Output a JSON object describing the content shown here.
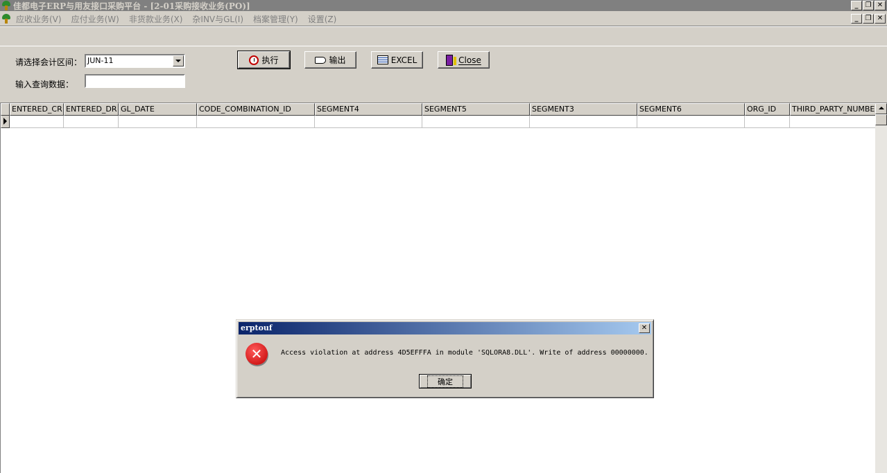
{
  "window": {
    "title": "佳都电子ERP与用友接口采购平台 - [2-01采购接收业务(PO)]",
    "btn_minimize": "_",
    "btn_restore": "❐",
    "btn_close": "✕"
  },
  "menu": {
    "items": [
      "应收业务(V)",
      "应付业务(W)",
      "非货款业务(X)",
      "杂INV与GL(I)",
      "档案管理(Y)",
      "设置(Z)"
    ]
  },
  "form": {
    "period_label": "请选择会计区间：",
    "period_value": "JUN-11",
    "query_label": "输入查询数据：",
    "query_value": ""
  },
  "toolbar": {
    "execute": "执行",
    "export": "输出",
    "excel": "EXCEL",
    "close": "Close"
  },
  "grid": {
    "columns": [
      "ENTERED_CR",
      "ENTERED_DR",
      "GL_DATE",
      "CODE_COMBINATION_ID",
      "SEGMENT4",
      "SEGMENT5",
      "SEGMENT3",
      "SEGMENT6",
      "ORG_ID",
      "THIRD_PARTY_NUMBER"
    ]
  },
  "dialog": {
    "title": "erptouf",
    "message": "Access violation at address 4D5EFFFA in module 'SQLORA8.DLL'. Write of address 00000000.",
    "ok_label": "确定",
    "close_glyph": "✕",
    "error_glyph": "✕"
  }
}
